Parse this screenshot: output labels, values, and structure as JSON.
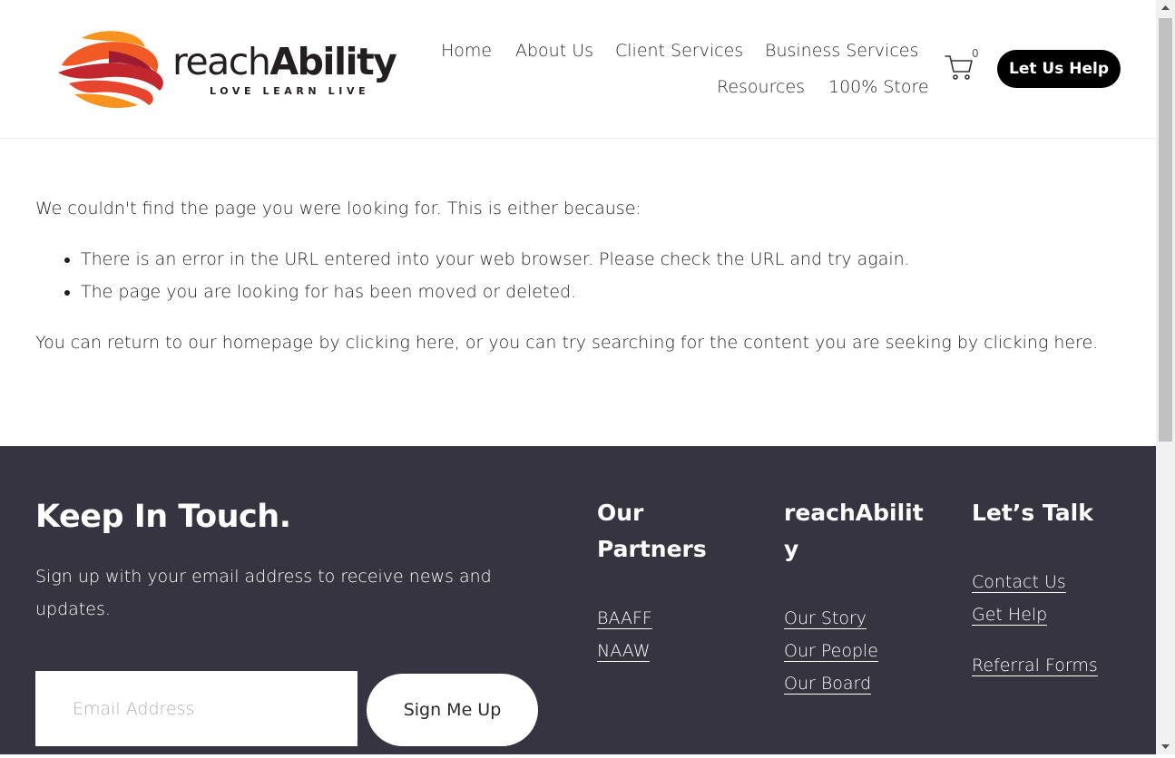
{
  "header": {
    "logo": {
      "word_light": "reach",
      "word_bold": "Ability",
      "tagline": "LOVE LEARN LIVE"
    },
    "nav": [
      {
        "label": "Home"
      },
      {
        "label": "About Us"
      },
      {
        "label": "Client Services"
      },
      {
        "label": "Business Services"
      },
      {
        "label": "Resources"
      },
      {
        "label": "100% Store"
      }
    ],
    "cart": {
      "icon": "cart-icon",
      "count": "0"
    },
    "cta_label": "Let Us Help"
  },
  "content": {
    "intro": "We couldn't find the page you were looking for. This is either because:",
    "reasons": [
      "There is an error in the URL entered into your web browser. Please check the URL and try again.",
      "The page you are looking for has been moved or deleted."
    ],
    "return_text": "You can return to our homepage by clicking here, or you can try searching for the content you are seeking by clicking here."
  },
  "footer": {
    "title": "Keep In Touch.",
    "description": "Sign up with your email address to receive news and updates.",
    "email_placeholder": "Email Address",
    "signup_label": "Sign Me Up",
    "columns": [
      {
        "heading_lines": [
          "Our",
          "Partners"
        ],
        "links": [
          "BAAFF",
          "NAAW"
        ]
      },
      {
        "heading_lines": [
          "reachAbilit",
          "y"
        ],
        "links": [
          "Our Story",
          "Our People",
          "Our Board"
        ]
      },
      {
        "heading_lines": [
          "Let’s Talk"
        ],
        "links": [
          "Contact Us",
          "Get Help",
          "Referral Forms"
        ]
      }
    ]
  },
  "colors": {
    "footer_bg": "#353440",
    "cta_bg": "#000000",
    "logo_red": "#c8102e",
    "logo_orange": "#f58220"
  }
}
